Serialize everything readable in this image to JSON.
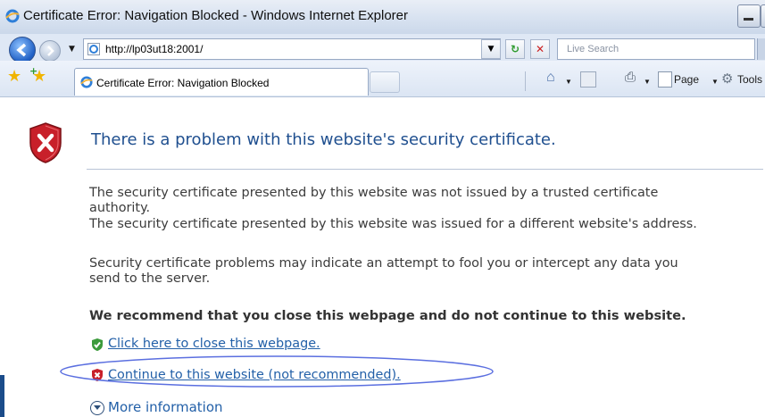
{
  "window": {
    "title": "Certificate Error: Navigation Blocked - Windows Internet Explorer"
  },
  "address_bar": {
    "url": "http://lp03ut18:2001/",
    "search_placeholder": "Live Search"
  },
  "tab": {
    "label": "Certificate Error: Navigation Blocked"
  },
  "toolbar": {
    "page_label": "Page",
    "tools_label": "Tools"
  },
  "content": {
    "headline": "There is a problem with this website's security certificate.",
    "paragraph1_line1": "The security certificate presented by this website was not issued by a trusted certificate",
    "paragraph1_line2": "authority.",
    "paragraph2": "The security certificate presented by this website was issued for a different website's address.",
    "paragraph3_line1": "Security certificate problems may indicate an attempt to fool you or intercept any data you",
    "paragraph3_line2": "send to the server.",
    "recommendation": "We recommend that you close this webpage and do not continue to this website.",
    "close_link": "Click here to close this webpage.",
    "continue_link": "Continue to this website (not recommended).",
    "more_info": "More information"
  },
  "colors": {
    "link": "#2360a8",
    "headline": "#1f4f8f",
    "shield_red": "#c8202a",
    "annotation_ellipse": "#5b6fe0"
  },
  "icons": [
    "ie-logo-icon",
    "back-arrow-icon",
    "forward-arrow-icon",
    "refresh-icon",
    "stop-icon",
    "favorites-star-icon",
    "add-favorite-icon",
    "home-icon",
    "feeds-icon",
    "print-icon",
    "page-icon",
    "tools-gear-icon",
    "shield-x-icon",
    "green-check-shield-icon",
    "red-x-shield-icon",
    "expand-circle-icon"
  ]
}
